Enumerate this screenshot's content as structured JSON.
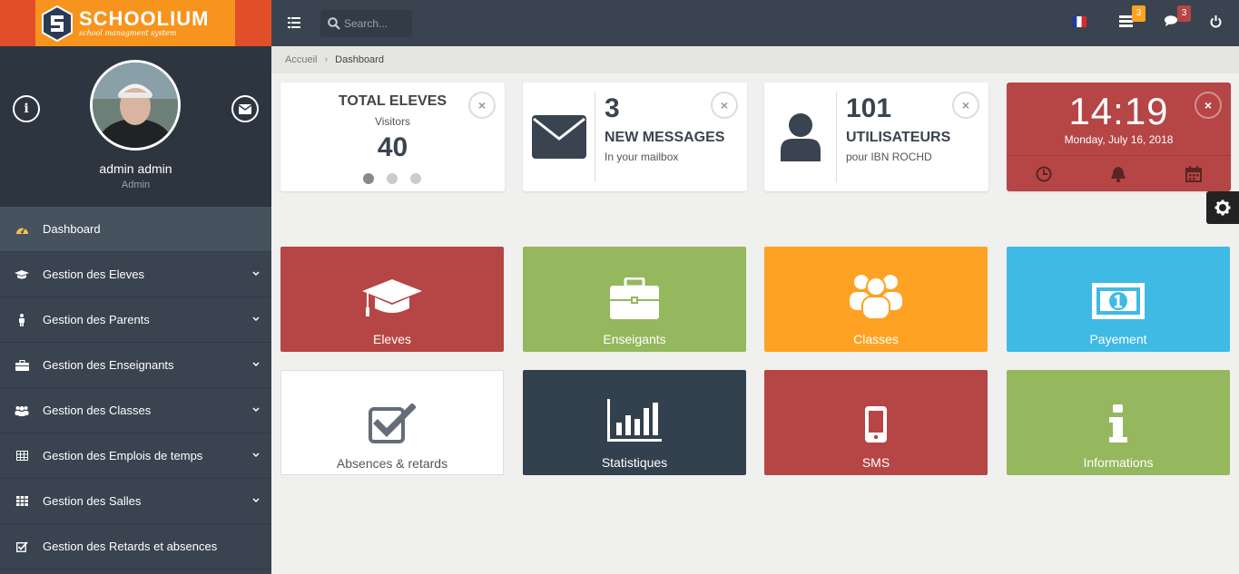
{
  "brand": {
    "name": "SCHOOLIUM",
    "tagline": "school managment system"
  },
  "profile": {
    "name": "admin admin",
    "role": "Admin"
  },
  "sidebar": {
    "items": [
      {
        "label": "Dashboard",
        "icon": "dashboard-icon"
      },
      {
        "label": "Gestion des Eleves",
        "icon": "graduation-cap-icon"
      },
      {
        "label": "Gestion des Parents",
        "icon": "user-icon"
      },
      {
        "label": "Gestion des Enseignants",
        "icon": "briefcase-icon"
      },
      {
        "label": "Gestion des Classes",
        "icon": "users-icon"
      },
      {
        "label": "Gestion des Emplois de temps",
        "icon": "table-icon"
      },
      {
        "label": "Gestion des Salles",
        "icon": "grid-icon"
      },
      {
        "label": "Gestion des Retards et absences",
        "icon": "check-square-icon"
      }
    ]
  },
  "topbar": {
    "search_placeholder": "Search...",
    "tasks_badge": "3",
    "messages_badge": "3"
  },
  "breadcrumb": {
    "home": "Accueil",
    "current": "Dashboard"
  },
  "widgets": {
    "students": {
      "title": "TOTAL ELEVES",
      "subtitle": "Visitors",
      "value": "40"
    },
    "messages": {
      "count": "3",
      "label": "NEW MESSAGES",
      "sub": "In your mailbox"
    },
    "users": {
      "count": "101",
      "label": "UTILISATEURS",
      "sub": "pour IBN ROCHD"
    },
    "clock": {
      "time": "14:19",
      "date": "Monday, July 16, 2018"
    }
  },
  "tiles": [
    {
      "label": "Eleves",
      "icon": "graduation-cap-icon",
      "color": "#b64545"
    },
    {
      "label": "Enseigants",
      "icon": "briefcase-icon",
      "color": "#95b75d"
    },
    {
      "label": "Classes",
      "icon": "users-icon",
      "color": "#fea223"
    },
    {
      "label": "Payement",
      "icon": "money-icon",
      "color": "#3fbae4"
    },
    {
      "label": "Absences & retards",
      "icon": "check-square-icon",
      "color": "#ffffff"
    },
    {
      "label": "Statistiques",
      "icon": "bar-chart-icon",
      "color": "#33414e"
    },
    {
      "label": "SMS",
      "icon": "mobile-icon",
      "color": "#b64545"
    },
    {
      "label": "Informations",
      "icon": "info-icon",
      "color": "#95b75d"
    }
  ]
}
